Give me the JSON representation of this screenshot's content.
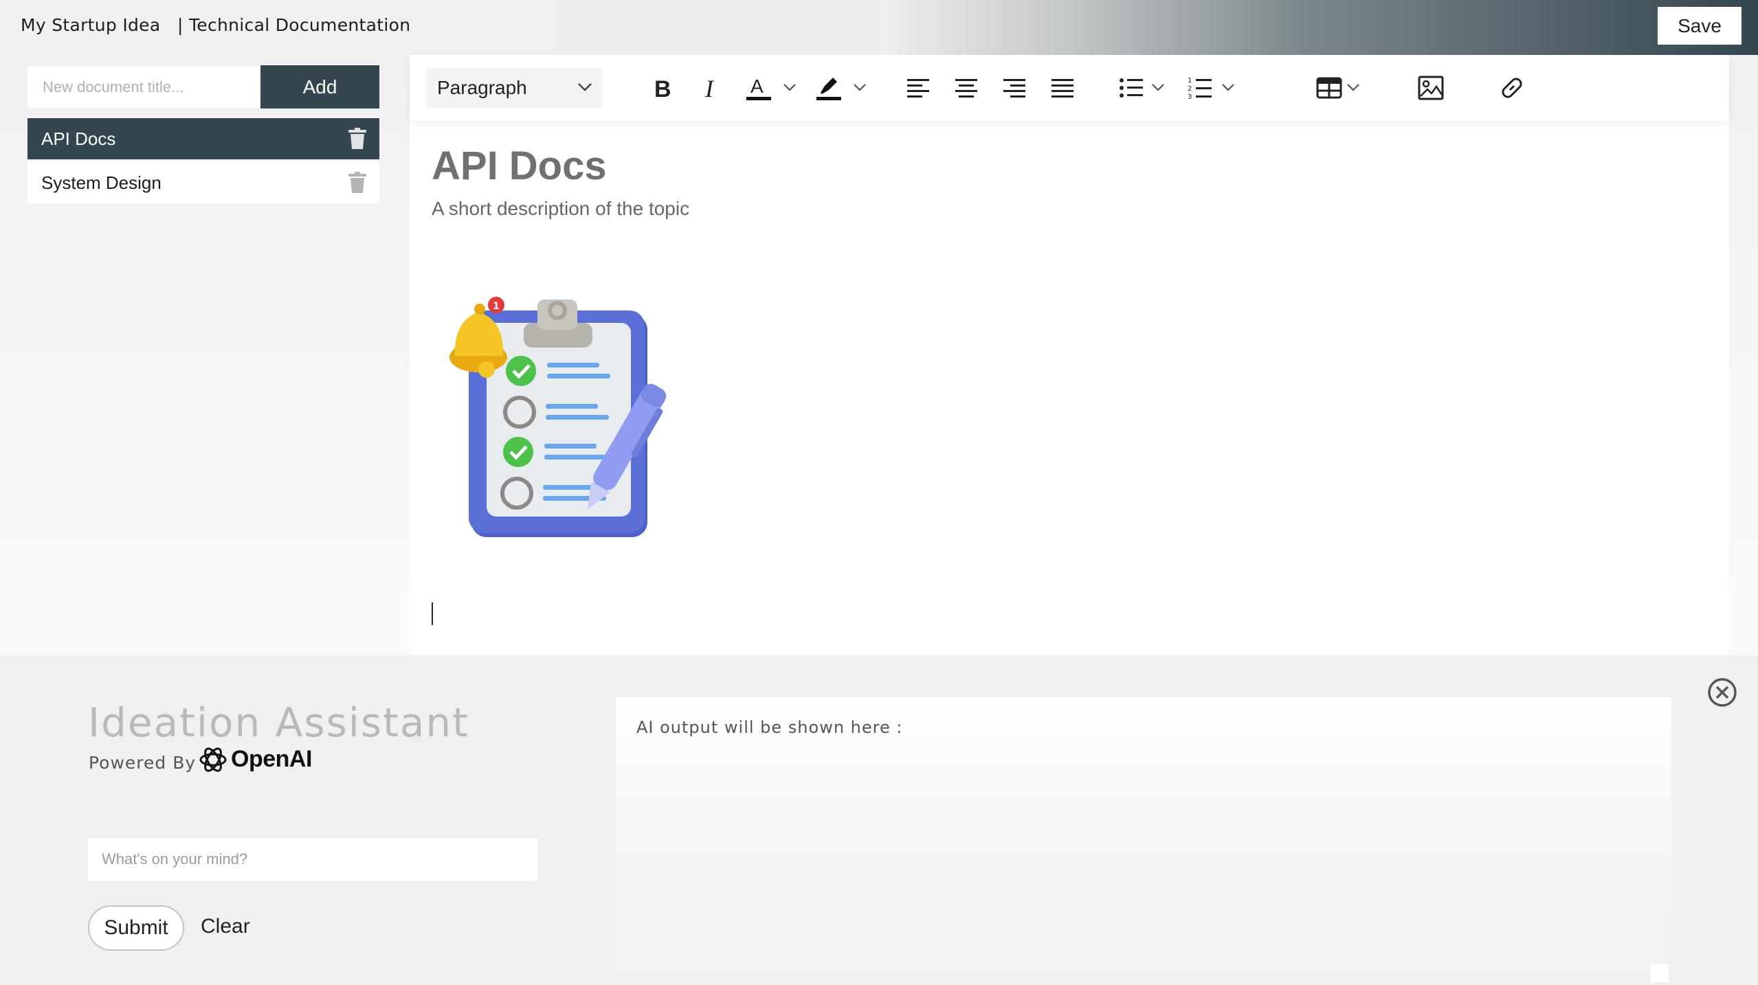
{
  "header": {
    "project_name": "My Startup Idea",
    "doc_type": "|  Technical Documentation",
    "save_label": "Save"
  },
  "sidebar": {
    "new_doc_placeholder": "New document title...",
    "add_label": "Add",
    "documents": [
      {
        "title": "API Docs",
        "active": true
      },
      {
        "title": "System Design",
        "active": false
      }
    ]
  },
  "editor": {
    "block_format": "Paragraph",
    "toolbar_icons": [
      "bold-icon",
      "italic-icon",
      "text-color-icon",
      "highlight-icon",
      "align-left-icon",
      "align-center-icon",
      "align-right-icon",
      "align-justify-icon",
      "bullet-list-icon",
      "numbered-list-icon",
      "table-icon",
      "image-icon",
      "link-icon"
    ],
    "document_title": "API Docs",
    "document_description": "A short description of the topic",
    "illustration": "clipboard-checklist-illustration"
  },
  "assistant": {
    "title": "Ideation Assistant",
    "powered_by": "Powered By",
    "provider": "OpenAI",
    "prompt_placeholder": "What's on your mind?",
    "submit_label": "Submit",
    "clear_label": "Clear",
    "output_label": "AI output will be shown here :"
  },
  "colors": {
    "accent": "#34464f",
    "background": "#f0f0f0",
    "surface": "#ffffff"
  }
}
